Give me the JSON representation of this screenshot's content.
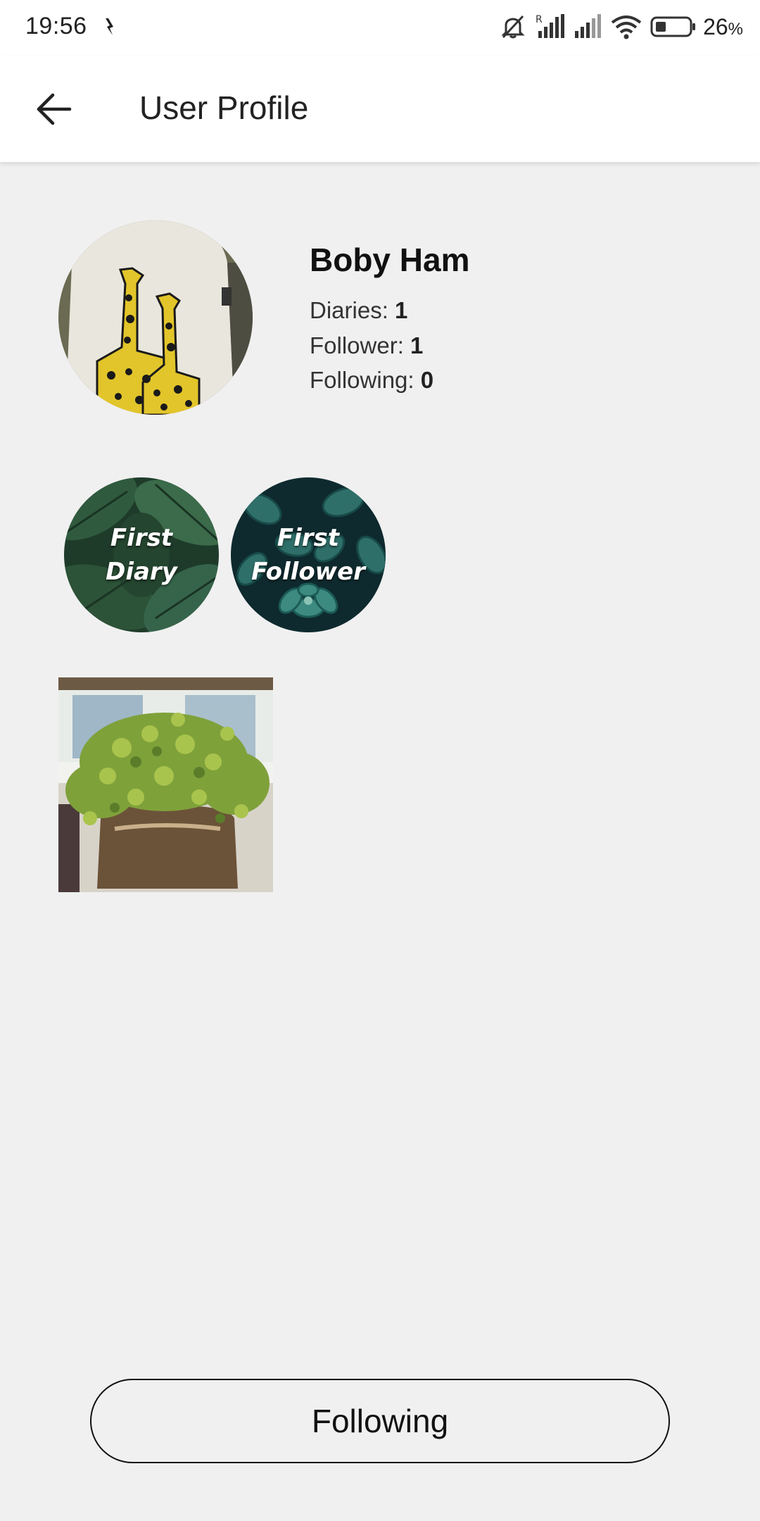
{
  "status_bar": {
    "time": "19:56",
    "battery_level": "26",
    "battery_unit": "%",
    "icons": [
      "notification-icon",
      "mute-icon",
      "signal-roaming-icon",
      "signal-icon",
      "wifi-icon",
      "battery-icon"
    ]
  },
  "app_bar": {
    "title": "User Profile",
    "back_icon": "arrow-left-icon"
  },
  "profile": {
    "name": "Boby Ham",
    "stats": {
      "diaries_label": "Diaries: ",
      "diaries_value": "1",
      "follower_label": "Follower: ",
      "follower_value": "1",
      "following_label": "Following: ",
      "following_value": "0"
    }
  },
  "badges": [
    {
      "line1": "First",
      "line2": "Diary"
    },
    {
      "line1": "First",
      "line2": "Follower"
    }
  ],
  "follow_button": {
    "label": "Following"
  },
  "colors": {
    "background": "#f0f0f0",
    "appbar": "#ffffff",
    "text": "#1a1a1a"
  }
}
